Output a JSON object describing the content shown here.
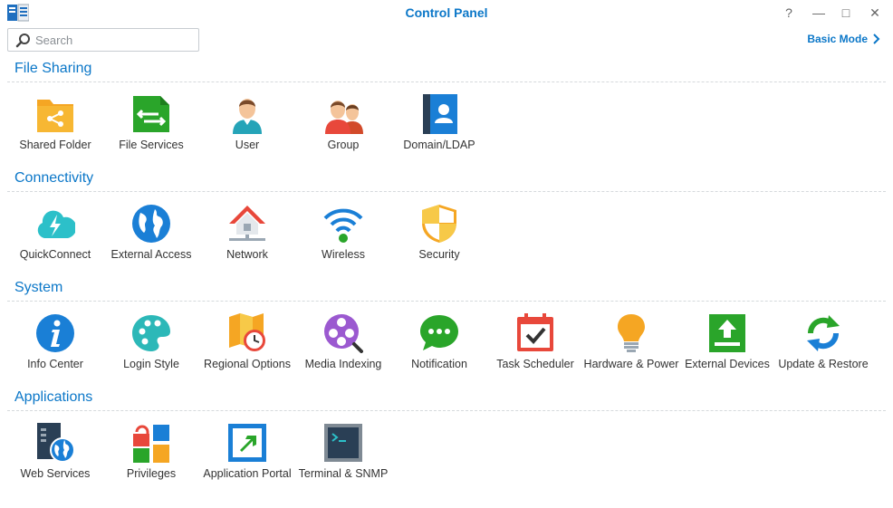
{
  "window": {
    "title": "Control Panel",
    "help_label": "?",
    "minimize_label": "—",
    "maximize_label": "□",
    "close_label": "✕"
  },
  "search": {
    "placeholder": "Search",
    "value": ""
  },
  "basic_mode": {
    "label": "Basic Mode"
  },
  "sections": {
    "file_sharing": {
      "title": "File Sharing",
      "items": [
        {
          "label": "Shared Folder",
          "icon": "shared-folder-icon"
        },
        {
          "label": "File Services",
          "icon": "file-services-icon"
        },
        {
          "label": "User",
          "icon": "user-icon"
        },
        {
          "label": "Group",
          "icon": "group-icon"
        },
        {
          "label": "Domain/LDAP",
          "icon": "domain-ldap-icon"
        }
      ]
    },
    "connectivity": {
      "title": "Connectivity",
      "items": [
        {
          "label": "QuickConnect",
          "icon": "quickconnect-icon"
        },
        {
          "label": "External Access",
          "icon": "external-access-icon"
        },
        {
          "label": "Network",
          "icon": "network-icon"
        },
        {
          "label": "Wireless",
          "icon": "wireless-icon"
        },
        {
          "label": "Security",
          "icon": "security-icon"
        }
      ]
    },
    "system": {
      "title": "System",
      "items": [
        {
          "label": "Info Center",
          "icon": "info-center-icon"
        },
        {
          "label": "Login Style",
          "icon": "login-style-icon"
        },
        {
          "label": "Regional Options",
          "icon": "regional-options-icon"
        },
        {
          "label": "Media Indexing",
          "icon": "media-indexing-icon"
        },
        {
          "label": "Notification",
          "icon": "notification-icon"
        },
        {
          "label": "Task Scheduler",
          "icon": "task-scheduler-icon"
        },
        {
          "label": "Hardware & Power",
          "icon": "hardware-power-icon"
        },
        {
          "label": "External Devices",
          "icon": "external-devices-icon"
        },
        {
          "label": "Update & Restore",
          "icon": "update-restore-icon"
        }
      ]
    },
    "applications": {
      "title": "Applications",
      "items": [
        {
          "label": "Web Services",
          "icon": "web-services-icon"
        },
        {
          "label": "Privileges",
          "icon": "privileges-icon"
        },
        {
          "label": "Application Portal",
          "icon": "application-portal-icon"
        },
        {
          "label": "Terminal & SNMP",
          "icon": "terminal-snmp-icon"
        }
      ]
    }
  },
  "colors": {
    "accent": "#0b77c8",
    "green": "#2aa52a",
    "orange": "#f5a623",
    "blue": "#1a7fd6",
    "red": "#e8483b"
  }
}
